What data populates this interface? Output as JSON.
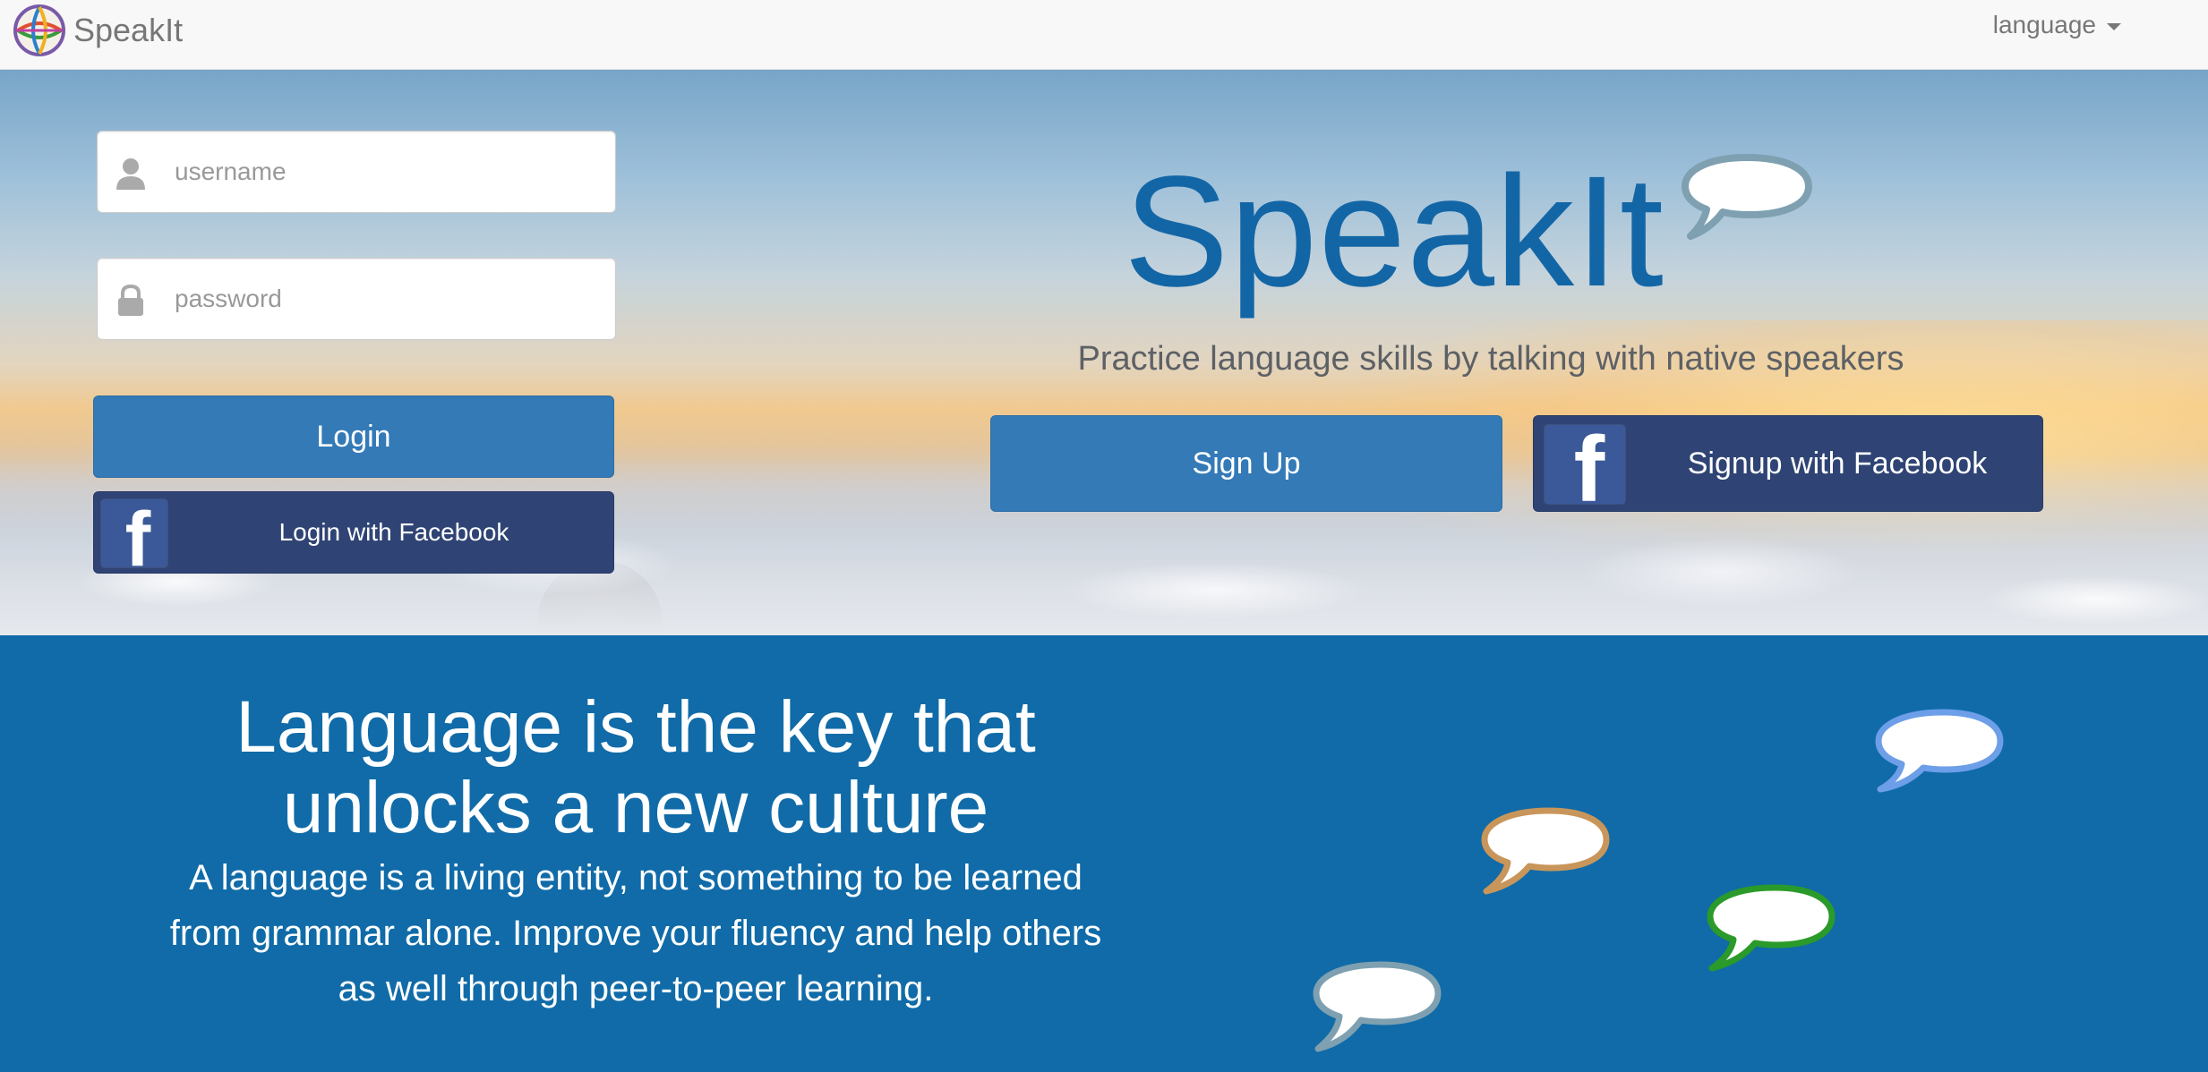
{
  "navbar": {
    "brand": "SpeakIt",
    "language_label": "language"
  },
  "login": {
    "username_placeholder": "username",
    "password_placeholder": "password",
    "login_label": "Login",
    "facebook_login_label": "Login with Facebook"
  },
  "hero": {
    "title": "SpeakIt",
    "tagline": "Practice language skills by talking with native speakers",
    "signup_label": "Sign Up",
    "facebook_signup_label": "Signup with Facebook"
  },
  "lower": {
    "heading_line1": "Language is the key that",
    "heading_line2": "unlocks a new culture",
    "body": "A language is a living entity, not something to be learned from grammar alone. Improve your fluency and help others as well through peer-to-peer learning."
  },
  "icons": {
    "brand_logo": "globe-logo-icon",
    "username": "user-icon",
    "password": "lock-icon",
    "facebook": "facebook-icon",
    "speech": "speech-bubble-icon",
    "dropdown": "caret-down-icon"
  },
  "colors": {
    "primary_button": "#337ab7",
    "facebook_button": "#2f4474",
    "title_blue": "#1366a6",
    "lower_band": "#106ba8",
    "bubble_tan": "#c8955a",
    "bubble_blue": "#6d9ee8",
    "bubble_green": "#2a9a2a",
    "bubble_gray": "#7ea0b0"
  }
}
